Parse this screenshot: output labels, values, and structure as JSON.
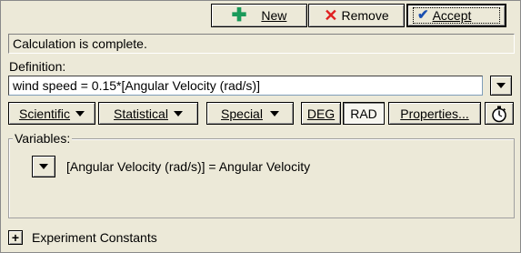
{
  "toolbar": {
    "new_label": "New",
    "remove_label": "Remove",
    "accept_label": "Accept"
  },
  "status_text": "Calculation is complete.",
  "definition": {
    "label": "Definition:",
    "value": "wind speed = 0.15*[Angular Velocity (rad/s)]"
  },
  "menus": {
    "scientific": "Scientific",
    "statistical": "Statistical",
    "special": "Special",
    "deg": "DEG",
    "rad": "RAD",
    "properties": "Properties..."
  },
  "variables": {
    "label": "Variables:",
    "item": "[Angular Velocity (rad/s)] = Angular Velocity"
  },
  "constants": {
    "expander": "+",
    "label": "Experiment Constants"
  },
  "icons": {
    "new": "plus-icon",
    "remove": "x-icon",
    "accept": "check-icon",
    "timer": "stopwatch-icon"
  }
}
